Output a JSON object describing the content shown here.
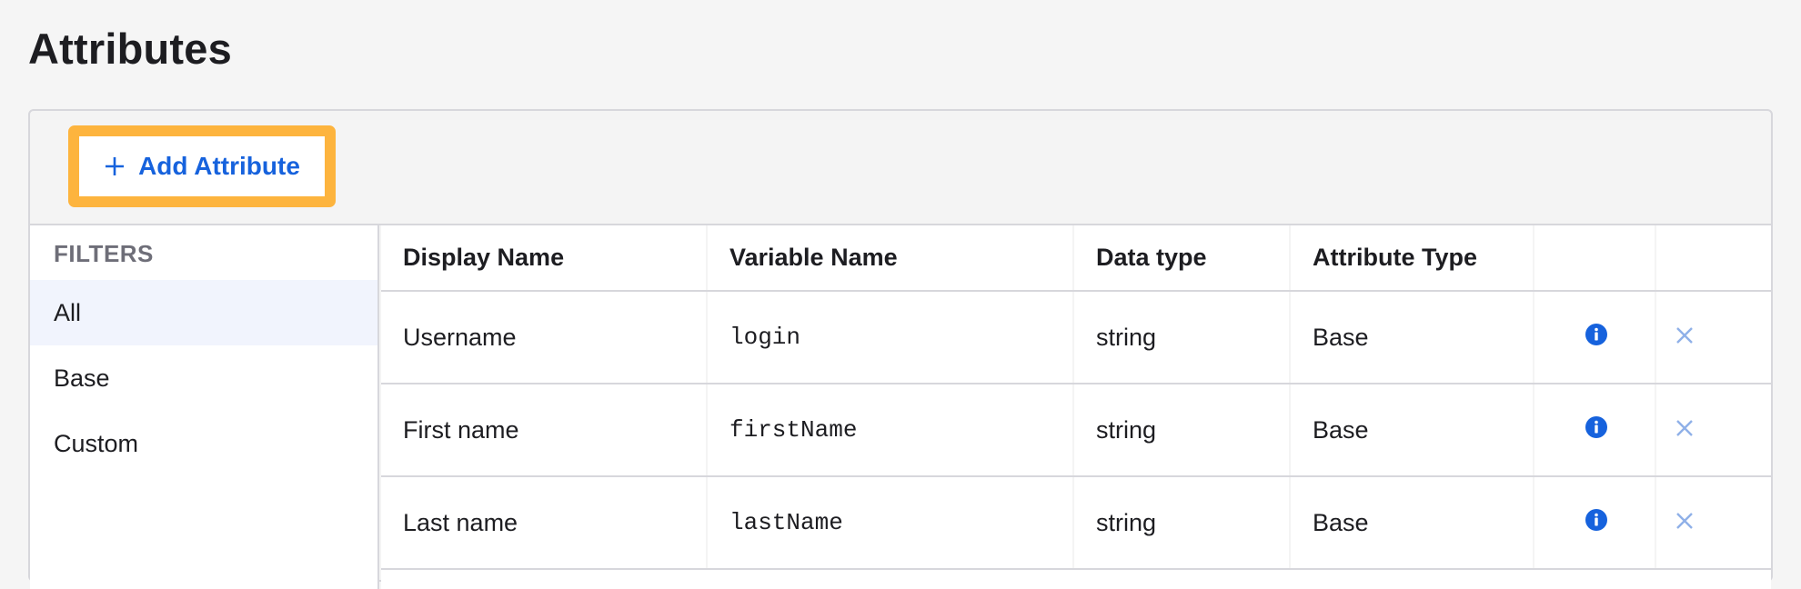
{
  "page": {
    "title": "Attributes"
  },
  "toolbar": {
    "add_label": "Add Attribute"
  },
  "filters": {
    "title": "FILTERS",
    "items": [
      {
        "label": "All",
        "active": true
      },
      {
        "label": "Base",
        "active": false
      },
      {
        "label": "Custom",
        "active": false
      }
    ]
  },
  "table": {
    "headers": [
      "Display Name",
      "Variable Name",
      "Data type",
      "Attribute Type"
    ],
    "rows": [
      {
        "display_name": "Username",
        "variable_name": "login",
        "data_type": "string",
        "attribute_type": "Base"
      },
      {
        "display_name": "First name",
        "variable_name": "firstName",
        "data_type": "string",
        "attribute_type": "Base"
      },
      {
        "display_name": "Last name",
        "variable_name": "lastName",
        "data_type": "string",
        "attribute_type": "Base"
      }
    ]
  },
  "icons": {
    "add": "plus-icon",
    "info": "info-icon",
    "remove": "close-icon"
  },
  "colors": {
    "accent": "#1662dd",
    "highlight": "#fdb43e",
    "remove_icon": "#8fb0e8"
  }
}
